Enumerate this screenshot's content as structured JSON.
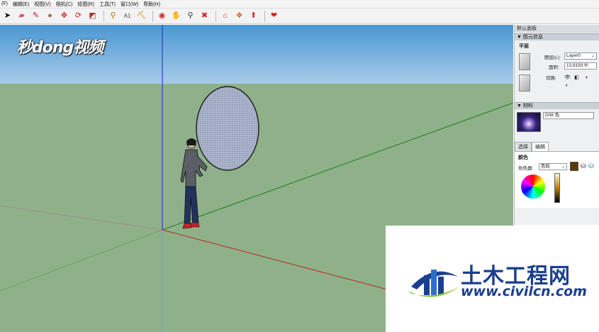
{
  "menu": [
    "(F)",
    "编辑(E)",
    "视图(V)",
    "相机(C)",
    "绘图(R)",
    "工具(T)",
    "窗口(W)",
    "帮助(H)"
  ],
  "toolbar_icons": [
    "select-arrow-icon",
    "eraser-icon",
    "line-pencil-icon",
    "paint-bucket-icon",
    "move-icon",
    "rotate-icon",
    "scale-icon",
    "tape-measure-icon",
    "text-icon",
    "paint-icon",
    "orbit-icon",
    "pan-icon",
    "zoom-icon",
    "zoom-extents-icon",
    "warehouse-icon",
    "components-icon",
    "upload-icon",
    "extension-icon"
  ],
  "watermark_top": "秒dong视频",
  "panel": {
    "title": "默认面板",
    "entity_info": {
      "header": "图元信息",
      "type": "平面",
      "layer_label": "图层(L):",
      "layer_value": "Layer0",
      "area_label": "面积:",
      "area_value": "13.8193 ft²",
      "toggle_label": "切换:"
    },
    "materials": {
      "header": "材料",
      "name": "D08 色"
    },
    "tabs": [
      "选择",
      "编辑"
    ],
    "color_label": "颜色",
    "picker_label": "拾色器:",
    "picker_value": "色轮"
  },
  "logo": {
    "cn": "土木工程网",
    "url": "www.civilcn.com"
  },
  "colors": {
    "sky": "#4a97d3",
    "ground": "#8fb18a",
    "accent": "#1b3f8f"
  }
}
